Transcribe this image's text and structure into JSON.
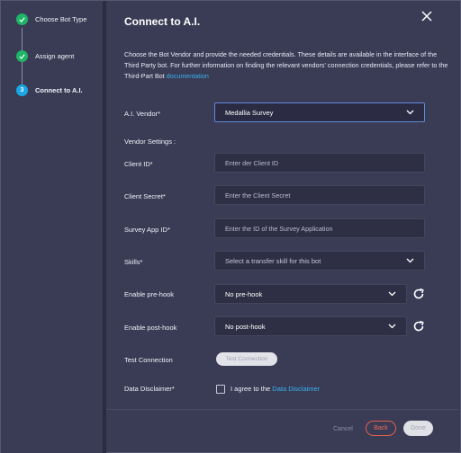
{
  "steps": [
    {
      "label": "Choose Bot Type",
      "status": "done"
    },
    {
      "label": "Assign agent",
      "status": "done"
    },
    {
      "label": "Connect to A.I.",
      "status": "active",
      "number": "3"
    }
  ],
  "dialog": {
    "title": "Connect to A.I.",
    "intro_text": "Choose the Bot Vendor and provide the needed credentials. These details are available in the interface of the Third Party bot. For further information on finding the relevant vendors' connection credentials, please refer to the Third-Part Bot ",
    "intro_link": "documentation"
  },
  "form": {
    "vendor_label": "A.I. Vendor*",
    "vendor_value": "Medallia Survey",
    "vendor_settings_label": "Vendor Settings :",
    "client_id_label": "Client ID*",
    "client_id_placeholder": "Enter der Client ID",
    "client_secret_label": "Client Secret*",
    "client_secret_placeholder": "Enter the Client Secret",
    "survey_app_label": "Survey App ID*",
    "survey_app_placeholder": "Enter the ID of the Survey Application",
    "skills_label": "Skills*",
    "skills_placeholder": "Select a transfer skill for this bot",
    "prehook_label": "Enable pre-hook",
    "prehook_value": "No pre-hook",
    "posthook_label": "Enable post-hook",
    "posthook_value": "No post-hook",
    "test_connection_label": "Test Connection",
    "test_connection_button": "Test Connection",
    "disclaimer_label": "Data Disclaimer*",
    "agree_text": "I agree to the ",
    "agree_link": "Data Disclaimer"
  },
  "footer": {
    "cancel": "Cancel",
    "back": "Back",
    "done": "Done"
  },
  "colors": {
    "background": "#3a3b55",
    "success": "#1fb567",
    "active": "#1ba7e6",
    "link": "#37b3f0",
    "back_accent": "#e0604d"
  }
}
